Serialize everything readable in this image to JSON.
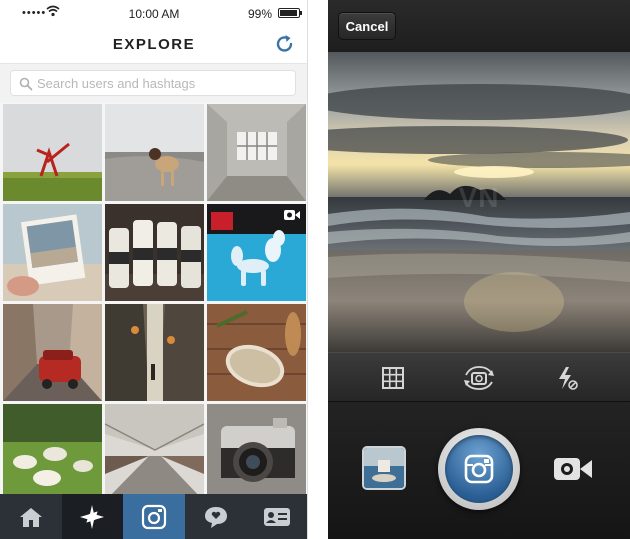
{
  "status_bar": {
    "signal": "•••••",
    "time": "10:00 AM",
    "battery": "99%",
    "battery_level": 0.99
  },
  "explore": {
    "title": "EXPLORE",
    "search_placeholder": "Search users and hashtags",
    "search_value": "",
    "photos": [
      {
        "subject": "red-sculpture-field",
        "video": false
      },
      {
        "subject": "dog-on-beach",
        "video": false
      },
      {
        "subject": "empty-room-window",
        "video": false
      },
      {
        "subject": "polaroid-in-hand",
        "video": false
      },
      {
        "subject": "milk-bottles",
        "video": false
      },
      {
        "subject": "balloon-dog",
        "video": true
      },
      {
        "subject": "city-street-red-car",
        "video": false
      },
      {
        "subject": "narrow-alley-lanterns",
        "video": false
      },
      {
        "subject": "bread-on-board",
        "video": false
      },
      {
        "subject": "lambs-on-grass",
        "video": false
      },
      {
        "subject": "train-station-platform",
        "video": false
      },
      {
        "subject": "vintage-camera",
        "video": false
      }
    ],
    "tabs": [
      {
        "name": "home",
        "icon": "home-icon",
        "active": false
      },
      {
        "name": "explore",
        "icon": "explore-star-icon",
        "active": true
      },
      {
        "name": "camera",
        "icon": "camera-icon",
        "active": false
      },
      {
        "name": "activity",
        "icon": "activity-bubble-icon",
        "active": false
      },
      {
        "name": "profile",
        "icon": "profile-card-icon",
        "active": false
      }
    ]
  },
  "camera": {
    "cancel_label": "Cancel",
    "tools": [
      "grid-icon",
      "flip-camera-icon",
      "flash-off-icon"
    ],
    "watermark": "VN",
    "colors": {
      "shutter_blue": "#3a6e9e",
      "explore_tab_active": "#1b1f23",
      "camera_tab_active": "#3a6e9e",
      "tab_bar": "#2b3137"
    }
  }
}
